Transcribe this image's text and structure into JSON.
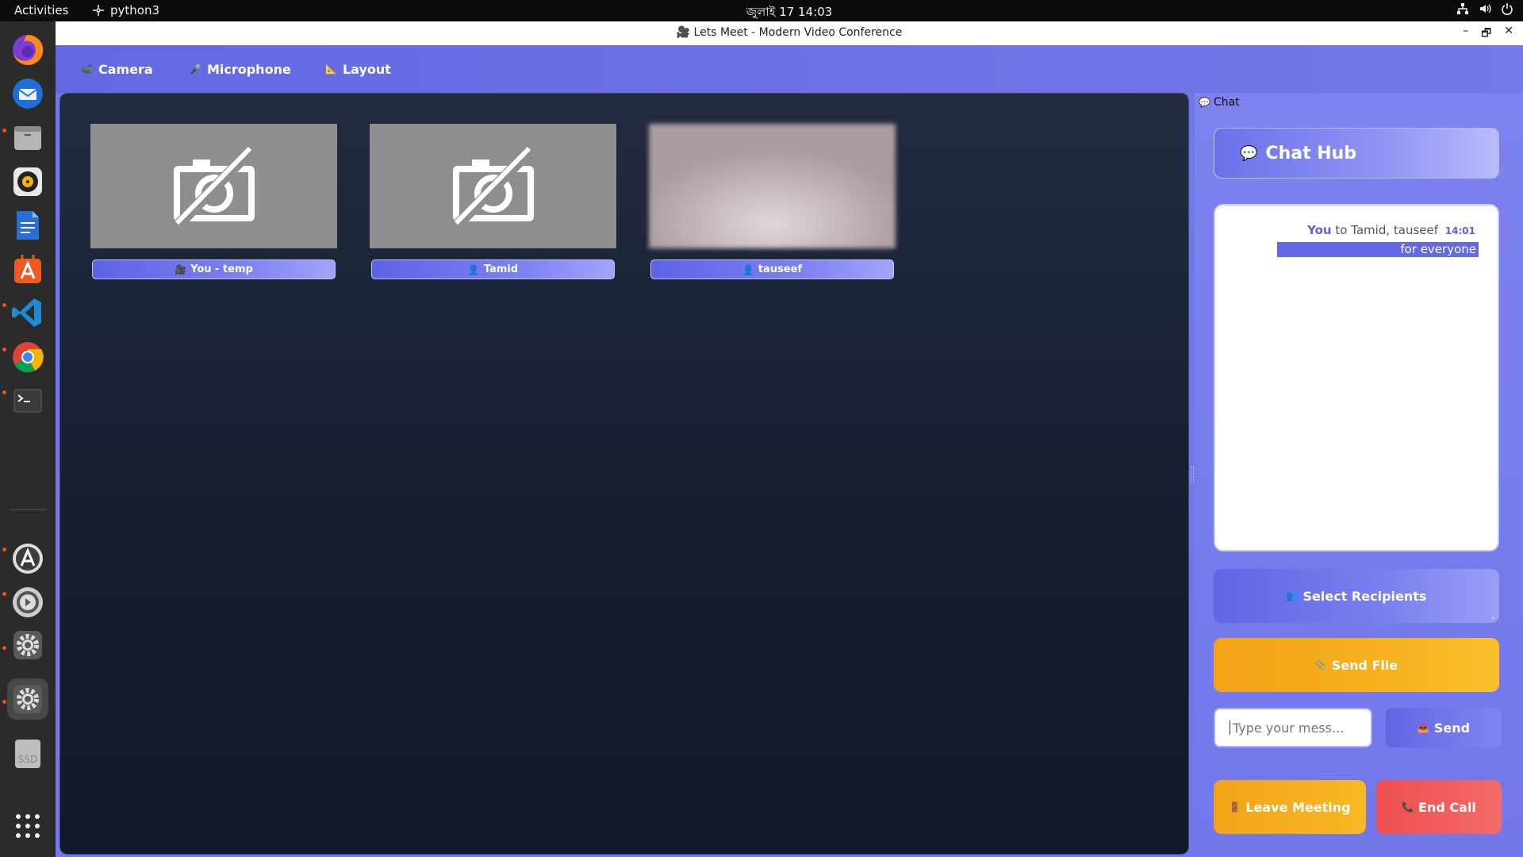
{
  "system": {
    "activities": "Activities",
    "app_name": "python3",
    "clock": "জুলাই 17  14:03"
  },
  "window": {
    "title": "🎥 Lets Meet - Modern Video Conference",
    "controls": {
      "minimize": "–",
      "maximize": "🗗",
      "close": "✕"
    }
  },
  "toolbar": {
    "camera": {
      "icon": "📹",
      "label": "Camera"
    },
    "microphone": {
      "icon": "🎤",
      "label": "Microphone"
    },
    "layout": {
      "icon": "📐",
      "label": "Layout"
    }
  },
  "participants": [
    {
      "icon": "🎥",
      "name": "You - temp",
      "video": "camera-off"
    },
    {
      "icon": "👤",
      "name": "Tamid",
      "video": "camera-off"
    },
    {
      "icon": "👤",
      "name": "tauseef",
      "video": "live-blurred"
    }
  ],
  "chat": {
    "tab_icon": "💬",
    "tab_label": "Chat",
    "hub_icon": "💬",
    "hub_title": "Chat Hub",
    "messages": [
      {
        "sender": "You",
        "to_text": "to Tamid, tauseef",
        "time": "14:01",
        "body": "for everyone"
      }
    ],
    "recipients": {
      "icon": "👥",
      "label": "Select Recipients"
    },
    "send_file": {
      "icon": "📎",
      "label": "Send File"
    },
    "input": {
      "placeholder": "Type your mess...",
      "value": ""
    },
    "send": {
      "icon": "📤",
      "label": "Send"
    },
    "leave": {
      "icon": "🚪",
      "label": "Leave Meeting"
    },
    "end": {
      "icon": "📞",
      "label": "End Call"
    }
  },
  "dock": [
    "firefox-icon",
    "thunderbird-icon",
    "files-icon",
    "rhythmbox-icon",
    "libreoffice-writer-icon",
    "app-center-icon",
    "vscode-icon",
    "chrome-icon",
    "terminal-icon",
    "software-updater-icon",
    "startup-disk-icon",
    "settings-icon",
    "settings-active-icon",
    "ssd-drive-icon",
    "show-apps-icon"
  ],
  "colors": {
    "accent": "#6a70e8",
    "send_file": "#f5a91a",
    "leave": "#f5ac1e",
    "end_call": "#f05b5d",
    "video_area": "#1a2133"
  }
}
